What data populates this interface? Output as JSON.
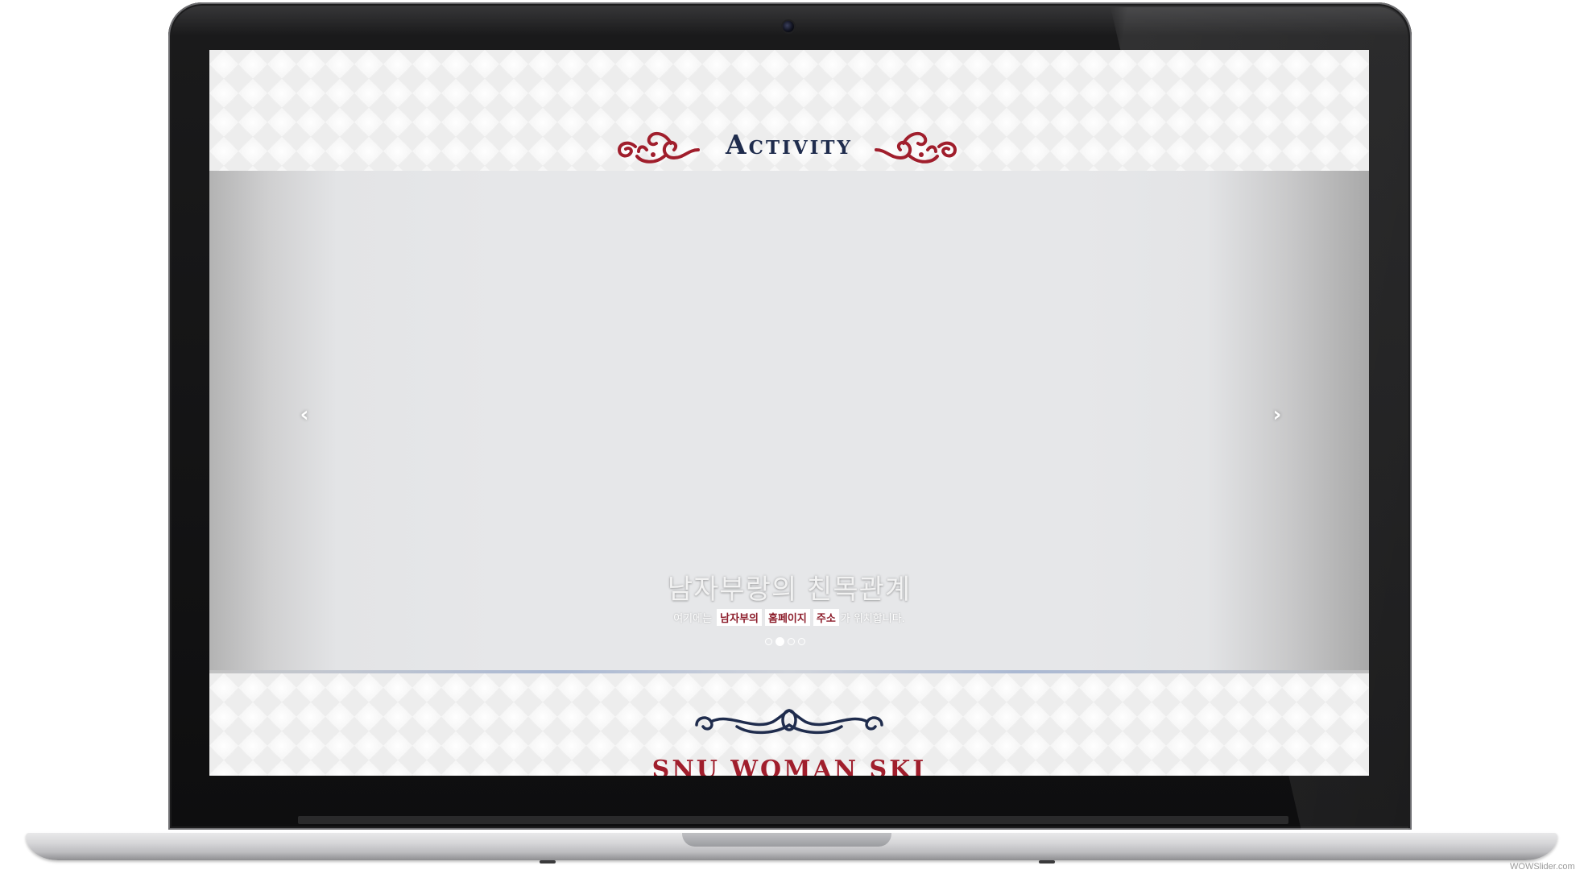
{
  "section": {
    "title": "Activity"
  },
  "slider": {
    "caption_title": "남자부랑의 친목관계",
    "caption_sub_before": "여기에는",
    "caption_sub_highlight_1": "남자부의",
    "caption_sub_highlight_2": "홈페이지",
    "caption_sub_highlight_3": "주소",
    "caption_sub_after": "가 위치합니다.",
    "prev_icon": "‹",
    "next_icon": "›",
    "slide_count": 4,
    "active_slide": 2
  },
  "footer_section": {
    "title": "SNU WOMAN SKI"
  },
  "credit": "WOWSlider.com",
  "colors": {
    "title_navy": "#1f2c4d",
    "accent_red": "#a01e2c",
    "slider_bg": "#e6e7e9"
  }
}
